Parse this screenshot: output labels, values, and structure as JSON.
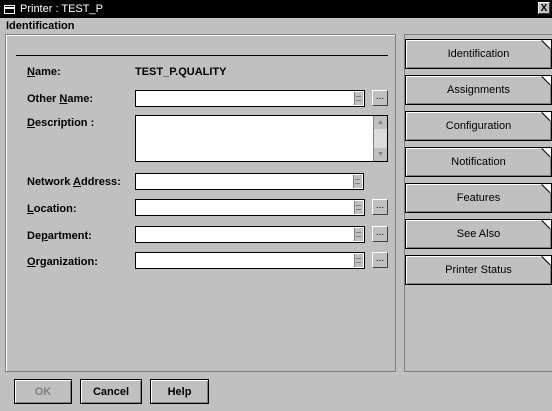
{
  "window": {
    "title": "Printer : TEST_P",
    "close_label": "X"
  },
  "section": {
    "title": "Identification"
  },
  "fields": {
    "name": {
      "label_pre": "",
      "label_ul": "N",
      "label_post": "ame:",
      "value": "TEST_P.QUALITY"
    },
    "other_name": {
      "label_pre": "Other ",
      "label_ul": "N",
      "label_post": "ame:",
      "value": ""
    },
    "description": {
      "label_pre": "",
      "label_ul": "D",
      "label_post": "escription :",
      "value": ""
    },
    "network_address": {
      "label_pre": "Network ",
      "label_ul": "A",
      "label_post": "ddress:",
      "value": ""
    },
    "location": {
      "label_pre": "",
      "label_ul": "L",
      "label_post": "ocation:",
      "value": ""
    },
    "department": {
      "label_pre": "De",
      "label_ul": "p",
      "label_post": "artment:",
      "value": ""
    },
    "organization": {
      "label_pre": "",
      "label_ul": "O",
      "label_post": "rganization:",
      "value": ""
    }
  },
  "dots_label": "...",
  "tabs": [
    {
      "label": "Identification",
      "active": true
    },
    {
      "label": "Assignments"
    },
    {
      "label": "Configuration"
    },
    {
      "label": "Notification"
    },
    {
      "label": "Features"
    },
    {
      "label": "See Also"
    },
    {
      "label": "Printer Status"
    }
  ],
  "buttons": {
    "ok": "OK",
    "cancel": "Cancel",
    "help": "Help"
  }
}
